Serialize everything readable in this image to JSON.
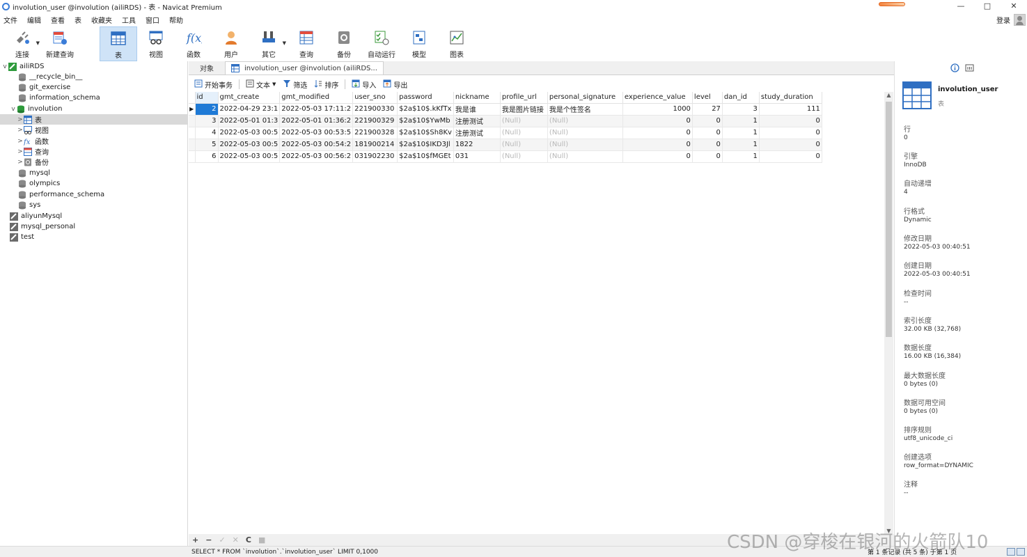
{
  "window": {
    "title": "involution_user @involution (ailiRDS) - 表 - Navicat Premium",
    "controls": [
      "—",
      "□",
      "✕"
    ]
  },
  "menu": {
    "items": [
      "文件",
      "编辑",
      "查看",
      "表",
      "收藏夹",
      "工具",
      "窗口",
      "帮助"
    ],
    "login": "登录"
  },
  "toolbar": {
    "buttons": [
      {
        "label": "连接",
        "icon": "plug-connect-icon"
      },
      {
        "label": "新建查询",
        "icon": "new-query-icon"
      },
      {
        "label": "表",
        "icon": "table-icon"
      },
      {
        "label": "视图",
        "icon": "view-icon"
      },
      {
        "label": "函数",
        "icon": "function-icon"
      },
      {
        "label": "用户",
        "icon": "user-icon"
      },
      {
        "label": "其它",
        "icon": "tools-icon"
      },
      {
        "label": "查询",
        "icon": "query-icon"
      },
      {
        "label": "备份",
        "icon": "backup-icon"
      },
      {
        "label": "自动运行",
        "icon": "auto-run-icon"
      },
      {
        "label": "模型",
        "icon": "model-icon"
      },
      {
        "label": "图表",
        "icon": "chart-icon"
      }
    ]
  },
  "tree": {
    "items": [
      {
        "label": "ailiRDS",
        "toggle": "v"
      },
      {
        "label": "__recycle_bin__",
        "toggle": ""
      },
      {
        "label": "git_exercise",
        "toggle": ""
      },
      {
        "label": "information_schema",
        "toggle": ""
      },
      {
        "label": "involution",
        "toggle": "v"
      },
      {
        "label": "表",
        "toggle": ">"
      },
      {
        "label": "视图",
        "toggle": ">"
      },
      {
        "label": "函数",
        "toggle": ">"
      },
      {
        "label": "查询",
        "toggle": ">"
      },
      {
        "label": "备份",
        "toggle": ">"
      },
      {
        "label": "mysql",
        "toggle": ""
      },
      {
        "label": "olympics",
        "toggle": ""
      },
      {
        "label": "performance_schema",
        "toggle": ""
      },
      {
        "label": "sys",
        "toggle": ""
      },
      {
        "label": "aliyunMysql",
        "toggle": ""
      },
      {
        "label": "mysql_personal",
        "toggle": ""
      },
      {
        "label": "test",
        "toggle": ""
      }
    ]
  },
  "tabs": {
    "objects": "对象",
    "active": "involution_user @involution (ailiRDS..."
  },
  "subtoolbar": {
    "begin_transaction": "开始事务",
    "text": "文本",
    "filter": "筛选",
    "sort": "排序",
    "import": "导入",
    "export": "导出"
  },
  "grid": {
    "columns": [
      "id",
      "gmt_create",
      "gmt_modified",
      "user_sno",
      "password",
      "nickname",
      "profile_url",
      "personal_signature",
      "experience_value",
      "level",
      "dan_id",
      "study_duration"
    ],
    "rows": [
      [
        "2",
        "2022-04-29 23:1",
        "2022-05-03 17:11:2",
        "221900330",
        "$2a$10$.kKfTx",
        "我是谁",
        "我是图片链接",
        "我是个性签名",
        "1000",
        "27",
        "3",
        "111"
      ],
      [
        "3",
        "2022-05-01 01:3",
        "2022-05-01 01:36:2",
        "221900329",
        "$2a$10$YwMb",
        "注册测试",
        "(Null)",
        "(Null)",
        "0",
        "0",
        "1",
        "0"
      ],
      [
        "4",
        "2022-05-03 00:5",
        "2022-05-03 00:53:5",
        "221900328",
        "$2a$10$Sh8Kv",
        "注册测试",
        "(Null)",
        "(Null)",
        "0",
        "0",
        "1",
        "0"
      ],
      [
        "5",
        "2022-05-03 00:5",
        "2022-05-03 00:54:2",
        "181900214",
        "$2a$10$IKD3Jl",
        "1822",
        "(Null)",
        "(Null)",
        "0",
        "0",
        "1",
        "0"
      ],
      [
        "6",
        "2022-05-03 00:5",
        "2022-05-03 00:56:2",
        "031902230",
        "$2a$10$fMGEt",
        "031",
        "(Null)",
        "(Null)",
        "0",
        "0",
        "1",
        "0"
      ]
    ]
  },
  "bottom_controls": [
    "+",
    "−",
    "✓",
    "✕",
    "C",
    "■"
  ],
  "status": {
    "sql": "SELECT * FROM `involution`.`involution_user` LIMIT 0,1000",
    "records": "第 1 条记录 (共 5 条) 于第 1 页"
  },
  "info": {
    "table_name": "involution_user",
    "type": "表",
    "fields": [
      {
        "key": "行",
        "value": "0"
      },
      {
        "key": "引擎",
        "value": "InnoDB"
      },
      {
        "key": "自动递增",
        "value": "4"
      },
      {
        "key": "行格式",
        "value": "Dynamic"
      },
      {
        "key": "修改日期",
        "value": "2022-05-03 00:40:51"
      },
      {
        "key": "创建日期",
        "value": "2022-05-03 00:40:51"
      },
      {
        "key": "检查时间",
        "value": "--"
      },
      {
        "key": "索引长度",
        "value": "32.00 KB (32,768)"
      },
      {
        "key": "数据长度",
        "value": "16.00 KB (16,384)"
      },
      {
        "key": "最大数据长度",
        "value": "0 bytes (0)"
      },
      {
        "key": "数据可用空间",
        "value": "0 bytes (0)"
      },
      {
        "key": "排序规则",
        "value": "utf8_unicode_ci"
      },
      {
        "key": "创建选项",
        "value": "row_format=DYNAMIC"
      },
      {
        "key": "注释",
        "value": "--"
      }
    ]
  },
  "watermark": "CSDN @穿梭在银河的火箭队10",
  "colors": {
    "accent": "#1f7ad6",
    "active_tool": "#cfe3f7",
    "selected_tree": "#d9d9d9"
  }
}
